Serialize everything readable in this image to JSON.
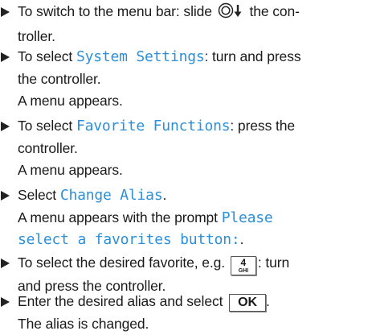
{
  "steps": [
    {
      "pre": "To switch to the menu bar: slide ",
      "icon": "controller-slide-down-icon",
      "post": " the con-",
      "line2": "troller."
    },
    {
      "pre": "To select ",
      "highlight": "System Settings",
      "post": ": turn and press",
      "line2": "the controller.",
      "line3": "A menu appears."
    },
    {
      "pre": "To select ",
      "highlight": "Favorite Functions",
      "post": ": press the",
      "line2": "controller.",
      "line3": "A menu appears."
    },
    {
      "pre": "Select ",
      "highlight": "Change Alias",
      "post": ".",
      "line2": "A menu appears with the prompt ",
      "highlight2": "Please",
      "line3": "select a favorites button:",
      "post3": "."
    },
    {
      "pre": "To select the desired favorite, e.g. ",
      "key_num": "4",
      "key_letters": "GHI",
      "post": ": turn",
      "line2": "and press the controller."
    },
    {
      "pre": "Enter the desired alias and select ",
      "key_label": "OK",
      "post": ".",
      "line2": "The alias is changed."
    }
  ],
  "colors": {
    "highlight": "#2b90d9",
    "text": "#1a1a1a"
  }
}
